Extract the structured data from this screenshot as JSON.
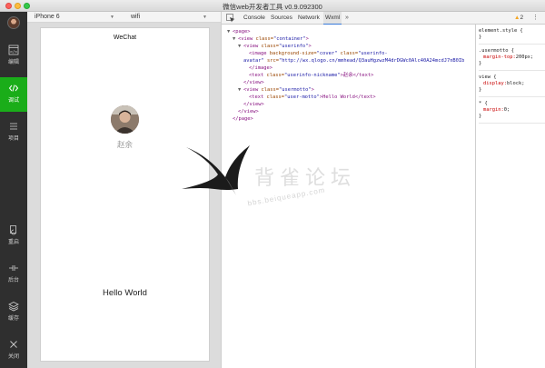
{
  "window": {
    "title": "微信web开发者工具 v0.9.092300"
  },
  "sidebar": {
    "items": [
      {
        "label": "编辑",
        "icon": "code-box-icon"
      },
      {
        "label": "调试",
        "icon": "debug-code-icon",
        "active": true
      },
      {
        "label": "项目",
        "icon": "menu-lines-icon"
      },
      {
        "label": "重启",
        "icon": "restart-icon"
      },
      {
        "label": "后台",
        "icon": "background-icon"
      },
      {
        "label": "缓存",
        "icon": "cache-stack-icon"
      },
      {
        "label": "关闭",
        "icon": "close-icon"
      }
    ],
    "active_color": "#1aad19"
  },
  "device_bar": {
    "device": "iPhone 6",
    "network": "wifi"
  },
  "simulator": {
    "nav_title": "WeChat",
    "nickname": "赵余",
    "motto": "Hello World"
  },
  "devtools": {
    "tabs": [
      "Console",
      "Sources",
      "Network",
      "Wxml"
    ],
    "active_tab": "Wxml",
    "more_label": "»",
    "warning_count": "2",
    "dom": {
      "l1": "<page>",
      "l2_tag": "<view",
      "l2_attr": "class=",
      "l2_val": "\"container\"",
      "l2_end": ">",
      "l3_tag": "<view",
      "l3_attr": "class=",
      "l3_val": "\"userinfo\"",
      "l3_end": ">",
      "l4_tag": "<image",
      "l4_attr1": "background-size=",
      "l4_val1": "\"cover\"",
      "l4_attr2": "class=",
      "l4_val2": "\"userinfo-",
      "l5_val": "avatar\"",
      "l5_attr": "src=",
      "l5_val2": "\"http://wx.qlogo.cn/mmhead/Q3auHgzwzM4drDGWc0Alc40A24mcdJ7nB0Ib",
      "l6": "</image>",
      "l7_tag": "<text",
      "l7_attr": "class=",
      "l7_val": "\"userinfo-nickname\"",
      "l7_text": ">赵余</text>",
      "l8": "</view>",
      "l9_tag": "<view",
      "l9_attr": "class=",
      "l9_val": "\"usermotto\"",
      "l9_end": ">",
      "l10_tag": "<text",
      "l10_attr": "class=",
      "l10_val": "\"user-motto\"",
      "l10_text": ">Hello World</text>",
      "l11": "</view>",
      "l12": "</view>",
      "l13": "</page>"
    },
    "styles": {
      "r1_sel": "element.style {",
      "r1_end": "}",
      "r2_sel": ".usermotto {",
      "r2_prop": "margin-top:",
      "r2_val": "200px;",
      "r2_end": "}",
      "r3_sel": "view {",
      "r3_prop": "display:",
      "r3_val": "block;",
      "r3_end": "}",
      "r4_sel": "* {",
      "r4_prop": "margin:",
      "r4_val": "0;",
      "r4_end": "}"
    }
  },
  "watermark": {
    "title": "背雀论坛",
    "url": "bbs.beiqueapp.com"
  }
}
